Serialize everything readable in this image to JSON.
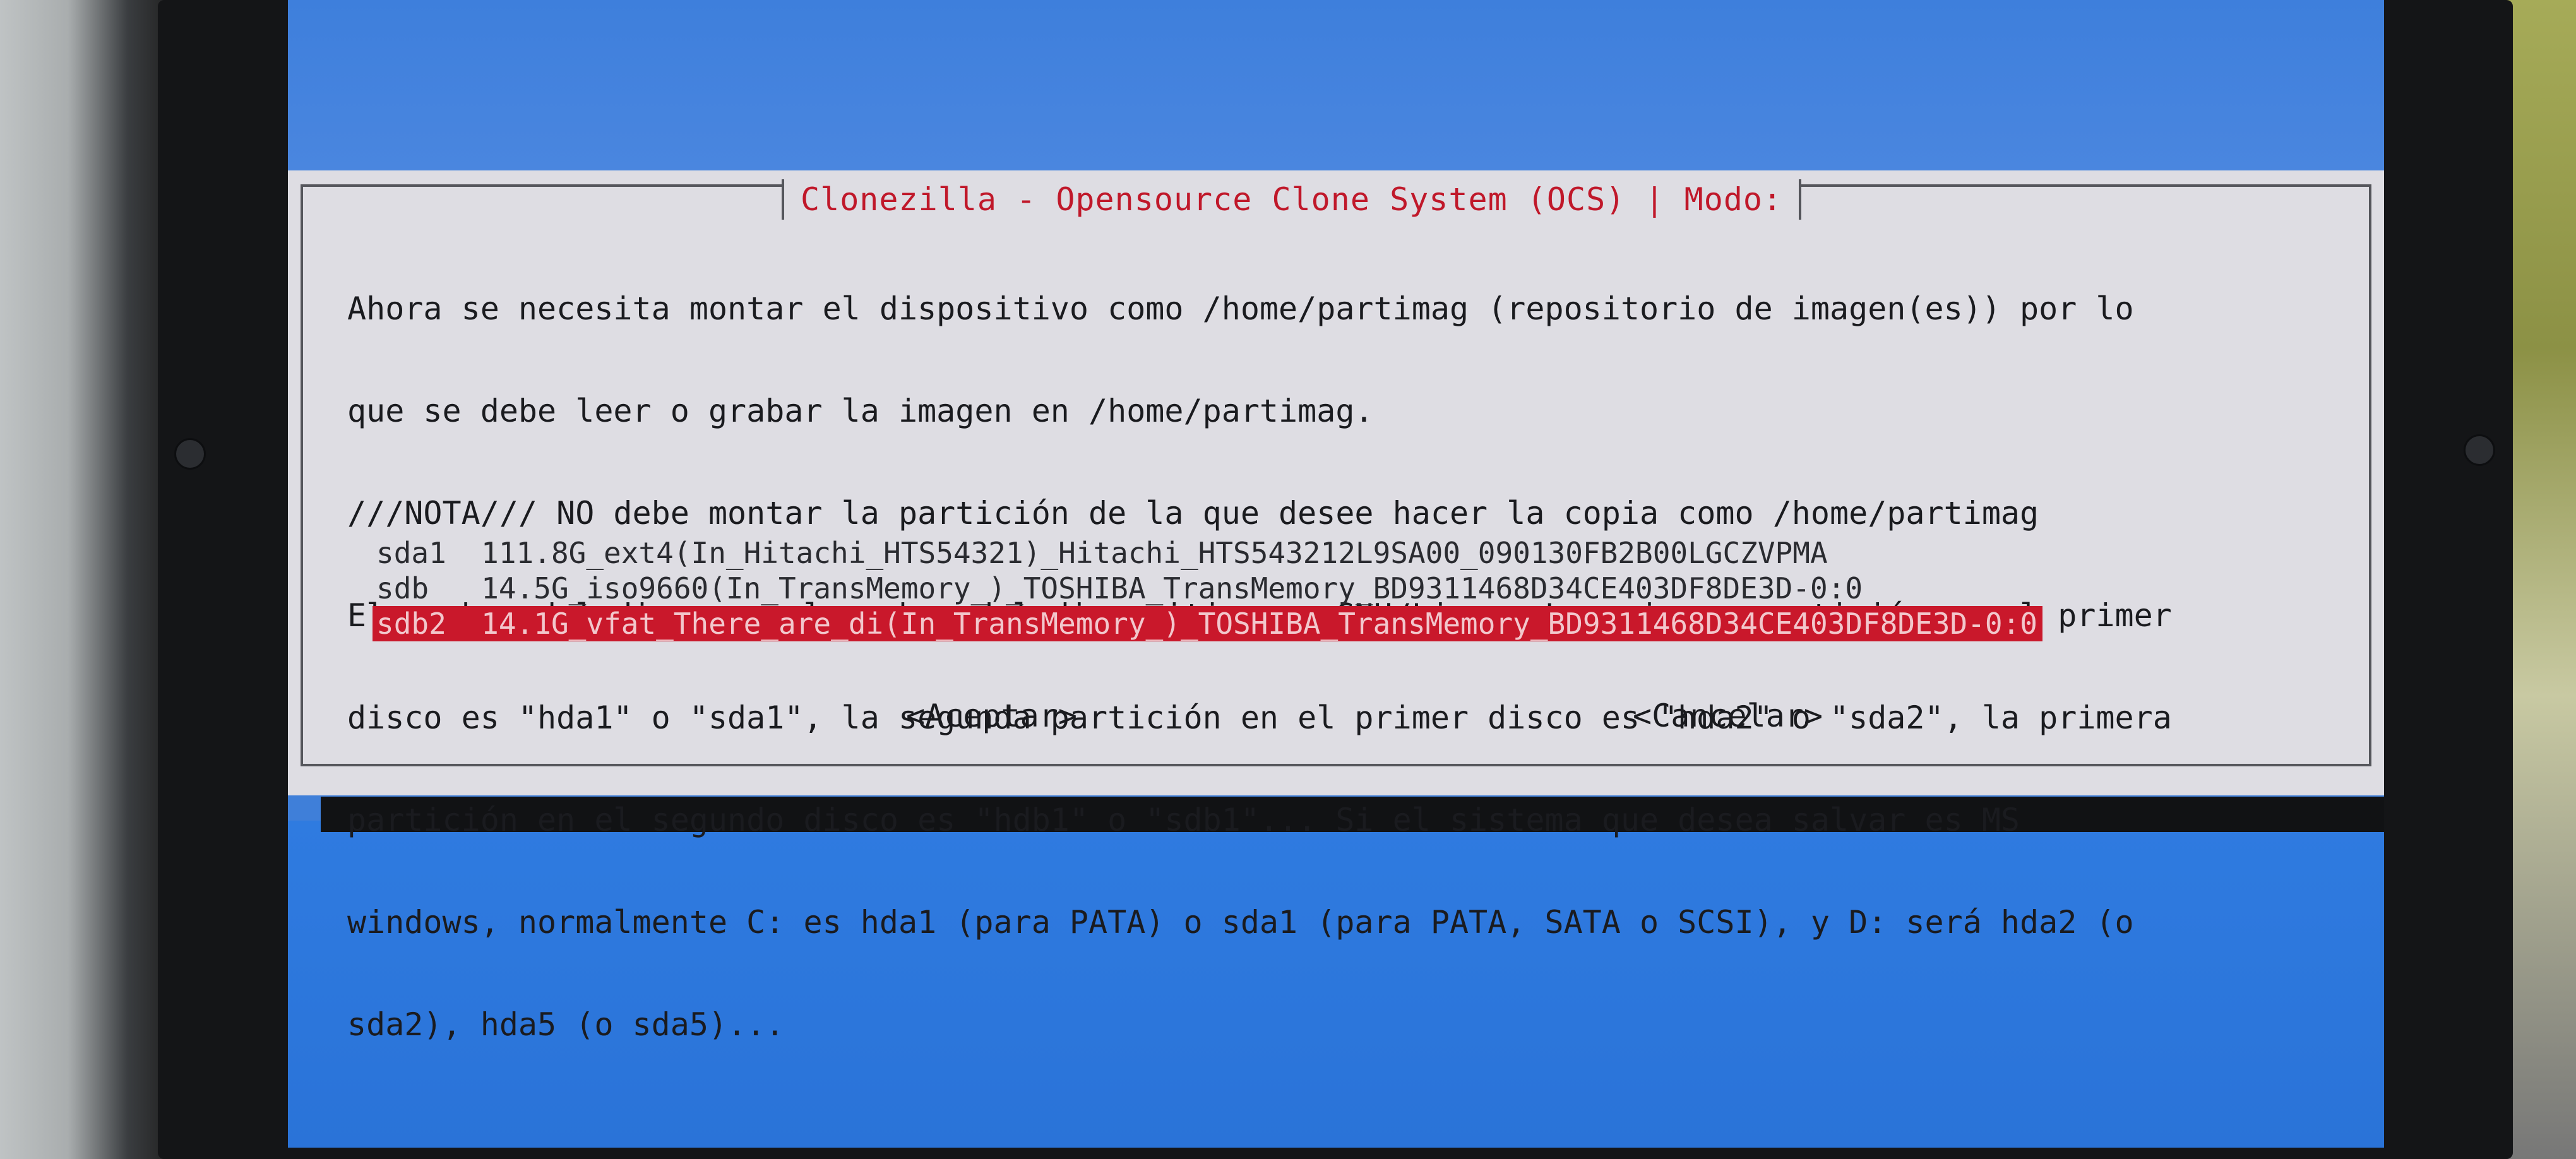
{
  "dialog": {
    "title": "Clonezilla - Opensource Clone System (OCS) | Modo:",
    "body_lines": [
      "Ahora se necesita montar el dispositivo como /home/partimag (repositorio de imagen(es)) por lo",
      "que se debe leer o grabar la imagen en /home/partimag.",
      "///NOTA/// NO debe montar la partición de la que desee hacer la copia como /home/partimag",
      "El nombre del disco es el nombre del dispositivo en GNU/Linux. La primera partición en el primer",
      "disco es \"hda1\" o \"sda1\", la segunda partición en el primer disco es \"hda2\" o \"sda2\", la primera",
      "partición en el segundo disco es \"hdb1\" o \"sdb1\"... Si el sistema que desea salvar es MS",
      "windows, normalmente C: es hda1 (para PATA) o sda1 (para PATA, SATA o SCSI), y D: será hda2 (o",
      "sda2), hda5 (o sda5)..."
    ],
    "devices": [
      {
        "name": "sda1",
        "info": "111.8G_ext4(In_Hitachi_HTS54321)_Hitachi_HTS543212L9SA00_090130FB2B00LGCZVPMA",
        "selected": false
      },
      {
        "name": "sdb",
        "info": "14.5G_iso9660(In_TransMemory_)_TOSHIBA_TransMemory_BD9311468D34CE403DF8DE3D-0:0",
        "selected": false
      },
      {
        "name": "sdb2",
        "info": "14.1G_vfat_There_are_di(In_TransMemory_)_TOSHIBA_TransMemory_BD9311468D34CE403DF8DE3D-0:0",
        "selected": true
      }
    ],
    "accept_label": "<Aceptar>",
    "cancel_label": "<Cancelar>"
  },
  "colors": {
    "screen_background": "#3f7fd9",
    "dialog_background": "#dedde3",
    "title_color": "#c0182a",
    "selection_background": "#c9182b"
  }
}
